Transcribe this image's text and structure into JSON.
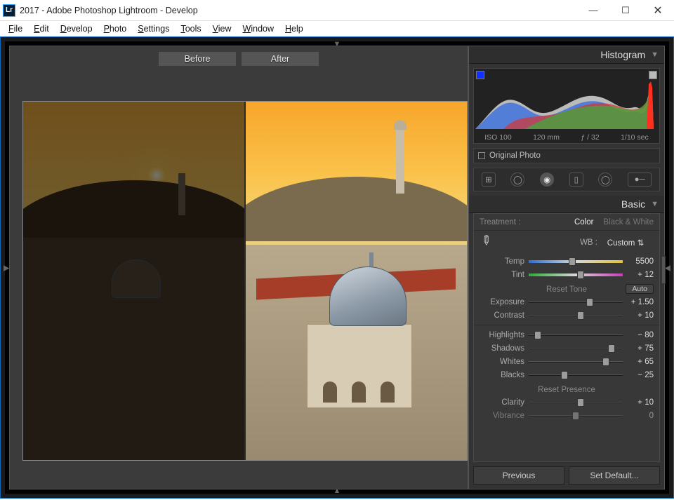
{
  "titlebar": {
    "icon_text": "Lr",
    "title": "2017 - Adobe Photoshop Lightroom - Develop"
  },
  "menu": [
    "File",
    "Edit",
    "Develop",
    "Photo",
    "Settings",
    "Tools",
    "View",
    "Window",
    "Help"
  ],
  "compare": {
    "before": "Before",
    "after": "After"
  },
  "panels": {
    "histogram_title": "Histogram",
    "histo_meta": {
      "iso": "ISO 100",
      "focal": "120 mm",
      "aperture": "ƒ / 32",
      "shutter": "1/10 sec"
    },
    "original_photo": "Original Photo",
    "basic_title": "Basic"
  },
  "treatment": {
    "label": "Treatment :",
    "color": "Color",
    "bw": "Black & White"
  },
  "wb": {
    "label": "WB :",
    "value": "Custom",
    "picker_icon": "eyedropper"
  },
  "sliders": {
    "temp": {
      "label": "Temp",
      "value": "5500",
      "pos": 46
    },
    "tint": {
      "label": "Tint",
      "value": "+ 12",
      "pos": 55
    },
    "exposure": {
      "label": "Exposure",
      "value": "+ 1.50",
      "pos": 65
    },
    "contrast": {
      "label": "Contrast",
      "value": "+ 10",
      "pos": 55
    },
    "highlights": {
      "label": "Highlights",
      "value": "− 80",
      "pos": 10
    },
    "shadows": {
      "label": "Shadows",
      "value": "+ 75",
      "pos": 88
    },
    "whites": {
      "label": "Whites",
      "value": "+ 65",
      "pos": 82
    },
    "blacks": {
      "label": "Blacks",
      "value": "− 25",
      "pos": 38
    },
    "clarity": {
      "label": "Clarity",
      "value": "+ 10",
      "pos": 55
    },
    "vibrance": {
      "label": "Vibrance",
      "value": "0",
      "pos": 50
    }
  },
  "subheads": {
    "tone": "Reset Tone",
    "auto": "Auto",
    "presence": "Reset Presence"
  },
  "footer": {
    "previous": "Previous",
    "set_default": "Set Default..."
  }
}
